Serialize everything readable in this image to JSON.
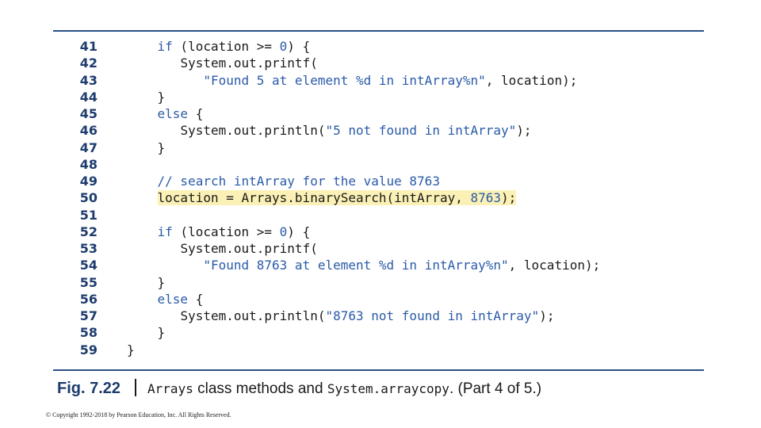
{
  "line_numbers": [
    "41",
    "42",
    "43",
    "44",
    "45",
    "46",
    "47",
    "48",
    "49",
    "50",
    "51",
    "52",
    "53",
    "54",
    "55",
    "56",
    "57",
    "58",
    "59"
  ],
  "code": {
    "l41": {
      "kw": "if",
      "rest1": " (location >= ",
      "num": "0",
      "rest2": ") {"
    },
    "l42": {
      "text": "System.out.printf("
    },
    "l43": {
      "str": "\"Found 5 at element %d in intArray%n\"",
      "rest": ", location);"
    },
    "l44": {
      "text": "}"
    },
    "l45": {
      "kw": "else",
      "rest": " {"
    },
    "l46": {
      "pre": "System.out.println(",
      "str": "\"5 not found in intArray\"",
      "post": ");"
    },
    "l47": {
      "text": "}"
    },
    "l48": {
      "text": ""
    },
    "l49": {
      "cmt": "// search intArray for the value 8763"
    },
    "l50": {
      "pre": "location = Arrays.binarySearch(intArray, ",
      "num": "8763",
      "post": ");"
    },
    "l51": {
      "text": ""
    },
    "l52": {
      "kw": "if",
      "rest1": " (location >= ",
      "num": "0",
      "rest2": ") {"
    },
    "l53": {
      "text": "System.out.printf("
    },
    "l54": {
      "str": "\"Found 8763 at element %d in intArray%n\"",
      "rest": ", location);"
    },
    "l55": {
      "text": "}"
    },
    "l56": {
      "kw": "else",
      "rest": " {"
    },
    "l57": {
      "pre": "System.out.println(",
      "str": "\"8763 not found in intArray\"",
      "post": ");"
    },
    "l58": {
      "text": "}"
    },
    "l59": {
      "text": "}"
    }
  },
  "caption": {
    "label": "Fig. 7.22",
    "mono1": "Arrays",
    "text1": " class methods and ",
    "mono2": "System.arraycopy",
    "text2": ". (Part 4 of 5.)"
  },
  "copyright": "© Copyright 1992-2018 by Pearson Education, Inc. All Rights Reserved.",
  "colors": {
    "accent": "#2a4f86",
    "code_accent": "#2a5aa8",
    "highlight": "#fbf1b6"
  }
}
